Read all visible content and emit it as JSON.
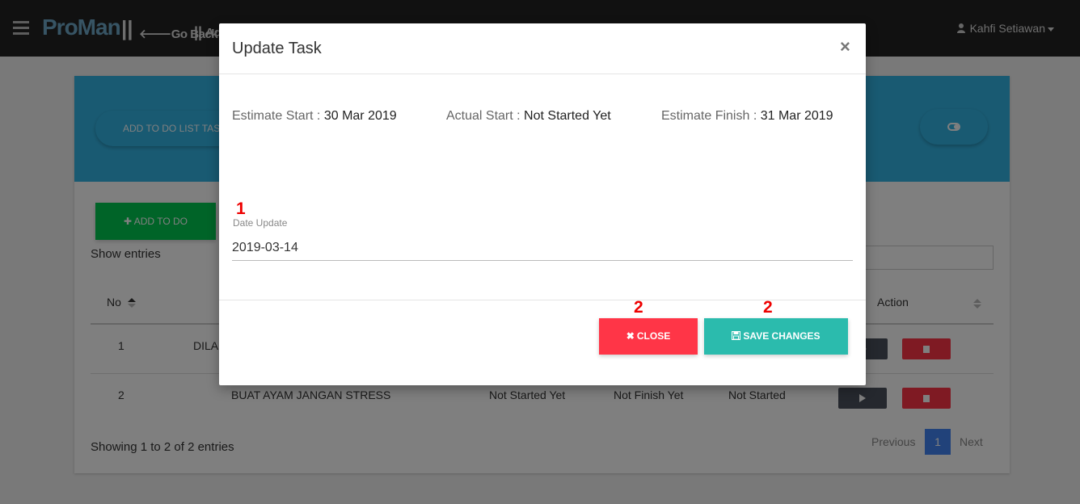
{
  "navbar": {
    "brand": "ProMan",
    "brand_sep": "||",
    "go_back": "Go Back",
    "go_back_sep": "||",
    "add_link": "Ad",
    "user_name": "Kahfi Setiawan"
  },
  "card": {
    "add_todo_list_label": "ADD TO DO LIST TASK",
    "add_todo_button": "ADD TO DO",
    "show_entries": "Show entries",
    "table": {
      "headers": {
        "no": "No",
        "action": "Action"
      },
      "rows": [
        {
          "no": "1",
          "task": "DILA",
          "actual_start": "",
          "actual_finish": "",
          "status": ""
        },
        {
          "no": "2",
          "task": "BUAT AYAM JANGAN STRESS",
          "actual_start": "Not Started Yet",
          "actual_finish": "Not Finish Yet",
          "status": "Not Started"
        }
      ]
    },
    "showing": "Showing 1 to 2 of 2 entries",
    "pagination": {
      "previous": "Previous",
      "current_page": "1",
      "next": "Next"
    }
  },
  "modal": {
    "title": "Update Task",
    "close_symbol": "×",
    "estimate_start_label": "Estimate Start :",
    "estimate_start_value": "30 Mar 2019",
    "actual_start_label": "Actual Start :",
    "actual_start_value": "Not Started Yet",
    "estimate_finish_label": "Estimate Finish :",
    "estimate_finish_value": "31 Mar 2019",
    "date_update_label": "Date Update",
    "date_update_value": "2019-03-14",
    "close_button": "CLOSE",
    "save_button": "SAVE CHANGES"
  },
  "annotations": {
    "marker_1": "1",
    "marker_2a": "2",
    "marker_2b": "2"
  },
  "colors": {
    "navbar": "#222222",
    "card_header": "#33b5e5",
    "add_button": "#00c851",
    "close_button": "#ff3547",
    "save_button": "#2bbbad",
    "page_active": "#4285f4",
    "marker": "#ee0000"
  },
  "icons": [
    "hamburger-icon",
    "arrow-left-icon",
    "user-icon",
    "caret-down-icon",
    "toggle-icon",
    "plus-icon",
    "sort-icon",
    "play-icon",
    "trash-icon",
    "times-icon",
    "save-icon"
  ]
}
